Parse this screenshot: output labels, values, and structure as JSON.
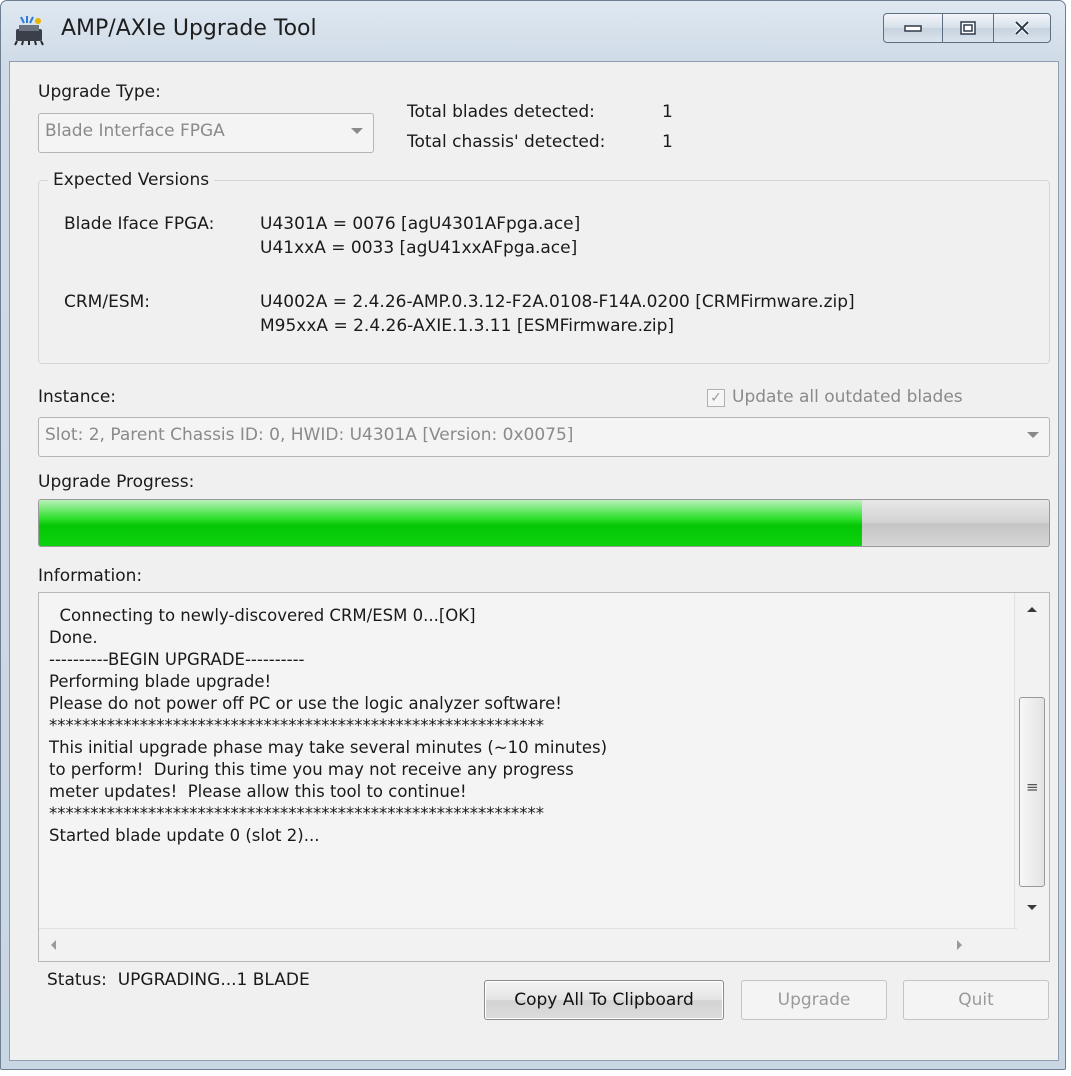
{
  "window": {
    "title": "AMP/AXIe Upgrade Tool",
    "icons": {
      "app": "chip-upgrade-icon",
      "minimize": "minimize-icon",
      "maximize": "maximize-icon",
      "close": "close-icon"
    }
  },
  "upgrade_type": {
    "label": "Upgrade Type:",
    "selected": "Blade Interface FPGA"
  },
  "detection": {
    "blades_label": "Total blades detected:",
    "blades_value": "1",
    "chassis_label": "Total chassis' detected:",
    "chassis_value": "1"
  },
  "expected_versions": {
    "title": "Expected Versions",
    "blade_iface_label": "Blade Iface FPGA:",
    "blade_iface_lines": [
      "U4301A = 0076 [agU4301AFpga.ace]",
      "U41xxA = 0033 [agU41xxAFpga.ace]"
    ],
    "crm_label": "CRM/ESM:",
    "crm_lines": [
      "U4002A = 2.4.26-AMP.0.3.12-F2A.0108-F14A.0200 [CRMFirmware.zip]",
      "M95xxA = 2.4.26-AXIE.1.3.11 [ESMFirmware.zip]"
    ]
  },
  "instance": {
    "label": "Instance:",
    "update_all_label": "Update all outdated blades",
    "update_all_checked": true,
    "selected": "Slot: 2, Parent Chassis ID: 0, HWID: U4301A [Version: 0x0075]"
  },
  "progress": {
    "label": "Upgrade Progress:",
    "fraction": 0.815
  },
  "information": {
    "label": "Information:",
    "lines": [
      "  Connecting to newly-discovered CRM/ESM 0...[OK]",
      "Done.",
      "----------BEGIN UPGRADE----------",
      "Performing blade upgrade!",
      "Please do not power off PC or use the logic analyzer software!",
      "************************************************************",
      "This initial upgrade phase may take several minutes (~10 minutes)",
      "to perform!  During this time you may not receive any progress",
      "meter updates!  Please allow this tool to continue!",
      "************************************************************",
      "Started blade update 0 (slot 2)..."
    ],
    "scroll_grip": "≡"
  },
  "status": {
    "text": "Status:  UPGRADING...1 BLADE"
  },
  "buttons": {
    "copy": "Copy All To Clipboard",
    "upgrade": "Upgrade",
    "quit": "Quit"
  },
  "colors": {
    "progress_green": "#06c706",
    "frame": "#cfdbe7",
    "client": "#f0f0f0"
  }
}
